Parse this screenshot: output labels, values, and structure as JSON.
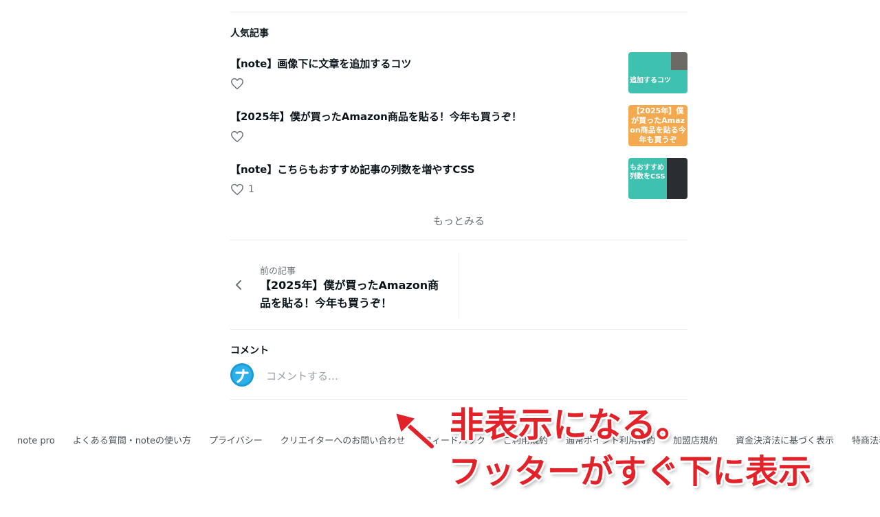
{
  "popular": {
    "heading": "人気記事",
    "items": [
      {
        "title": "【note】画像下に文章を追加するコツ",
        "likes": "",
        "thumb_text": "追加するコツ",
        "thumb_color": "#3fc1b0"
      },
      {
        "title": "【2025年】僕が買ったAmazon商品を貼る！今年も買うぞ！",
        "likes": "",
        "thumb_text": "【2025年】僕が買ったAmazon商品を貼る今年も買うぞ",
        "thumb_color": "#f5a94e"
      },
      {
        "title": "【note】こちらもおすすめ記事の列数を増やすCSS",
        "likes": "1",
        "thumb_text": "もおすすめ列数をCSS",
        "thumb_color": "#3fc1b0"
      }
    ],
    "more_label": "もっとみる"
  },
  "prev_article": {
    "label": "前の記事",
    "title": "【2025年】僕が買ったAmazon商品を貼る！今年も買うぞ！"
  },
  "comments": {
    "heading": "コメント",
    "placeholder": "コメントする…"
  },
  "footer": {
    "links": [
      "note pro",
      "よくある質問・noteの使い方",
      "プライバシー",
      "クリエイターへのお問い合わせ",
      "フィードバック",
      "ご利用規約",
      "通常ポイント利用特約",
      "加盟店規約",
      "資金決済法に基づく表示",
      "特商法表記"
    ]
  },
  "annotation": {
    "line1": "非表示になる。",
    "line2": "フッターがすぐ下に表示",
    "color": "#e32128"
  }
}
